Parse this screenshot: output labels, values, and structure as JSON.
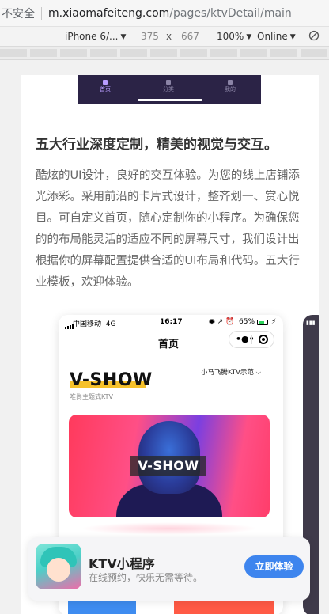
{
  "browser": {
    "security_label": "不安全",
    "url_host": "m.xiaomafeiteng.com",
    "url_path": "/pages/ktvDetail/main"
  },
  "device_toolbar": {
    "device": "iPhone 6/...",
    "width": "375",
    "times": "x",
    "height": "667",
    "zoom": "100%",
    "network": "Online"
  },
  "preview_tabbar": {
    "tabs": [
      "首页",
      "分类",
      "我的"
    ],
    "active_index": 0
  },
  "feature": {
    "title": "五大行业深度定制，精美的视觉与交互。",
    "description": "酷炫的UI设计，良好的交互体验。为您的线上店铺添光添彩。采用前沿的卡片式设计，整齐划一、赏心悦目。可自定义首页，随心定制你的小程序。为确保您的的布局能灵活的适应不同的屏幕尺寸，我们设计出根据你的屏幕配置提供合适的UI布局和代码。五大行业模板，欢迎体验。"
  },
  "phone_mockup": {
    "status": {
      "carrier": "中国移动",
      "network": "4G",
      "time": "16:17",
      "icons": "◉ ↗ ⏰",
      "battery": "65%",
      "battery_level": 0.65,
      "charging": "⚡"
    },
    "nav_title": "首页",
    "capsule_more": "•●•",
    "brand": "V-SHOW",
    "brand_subtitle": "唯尚主题式KTV",
    "shop_selector": "小马飞腾KTV示范",
    "banner_label": "V-SHOW"
  },
  "promo": {
    "title": "KTV小程序",
    "subtitle": "在线预约，快乐无需等待。",
    "button": "立即体验"
  },
  "colors": {
    "accent_blue": "#3e85ee",
    "brand_yellow": "#f6c12b",
    "preview_dark": "#2b2346"
  },
  "icons": {
    "rotate": "rotate-icon",
    "close": "close-circle-icon",
    "more": "more-dots-icon",
    "chevron": "chevron-down-icon"
  }
}
